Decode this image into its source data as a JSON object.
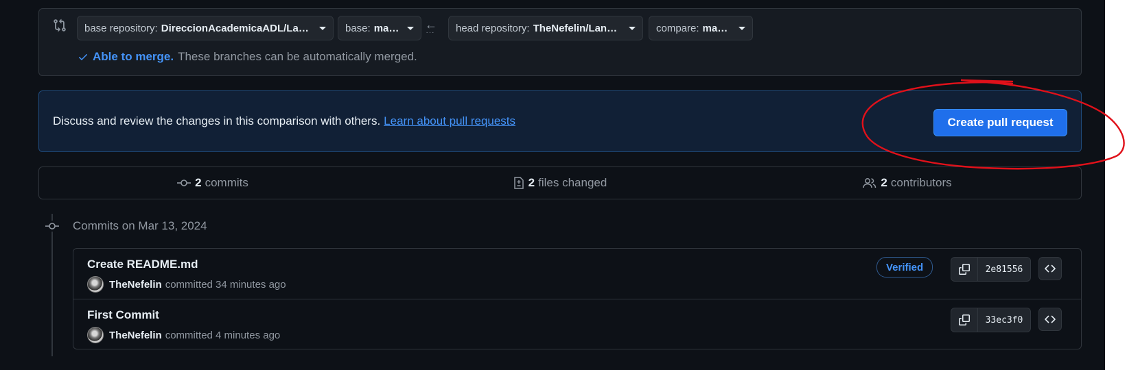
{
  "range": {
    "base_repo_prefix": "base repository:",
    "base_repo_value": "DireccionAcademicaADL/Landi…",
    "base_prefix": "base:",
    "base_value": "master",
    "head_repo_prefix": "head repository:",
    "head_repo_value": "TheNefelin/Landing",
    "compare_prefix": "compare:",
    "compare_value": "master",
    "merge_ok": "Able to merge.",
    "merge_message": "These branches can be automatically merged."
  },
  "create": {
    "discuss_text": "Discuss and review the changes in this comparison with others.",
    "learn_link": "Learn about pull requests",
    "button_label": "Create pull request"
  },
  "summary": {
    "commits_count": "2",
    "commits_label": "commits",
    "files_count": "2",
    "files_label": "files changed",
    "contributors_count": "2",
    "contributors_label": "contributors"
  },
  "commits_header": "Commits on Mar 13, 2024",
  "commits": [
    {
      "title": "Create README.md",
      "author": "TheNefelin",
      "time_text": "committed 34 minutes ago",
      "badge": "Verified",
      "sha": "2e81556"
    },
    {
      "title": "First Commit",
      "author": "TheNefelin",
      "time_text": "committed 4 minutes ago",
      "sha": "33ec3f0"
    }
  ],
  "colors": {
    "background": "#0d1117",
    "accent": "#4493f8",
    "primary_button": "#1f6feb",
    "annotation": "#e0111a"
  },
  "icons": {
    "compare": "git-compare-icon",
    "check": "check-icon",
    "commit": "git-commit-icon",
    "files": "file-diff-icon",
    "contributors": "people-icon",
    "copy": "copy-icon",
    "browse": "code-icon"
  }
}
